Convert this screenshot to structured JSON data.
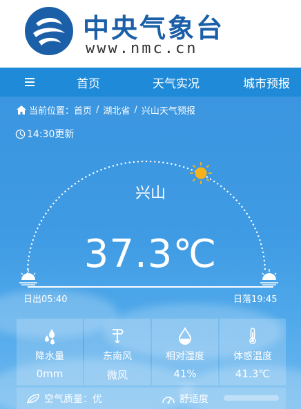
{
  "brand": {
    "name": "中央气象台",
    "url": "www.nmc.cn"
  },
  "nav": {
    "items": [
      {
        "label": "首页"
      },
      {
        "label": "天气实况"
      },
      {
        "label": "城市预报"
      }
    ]
  },
  "breadcrumb": {
    "prefix": "当前位置：",
    "home": "首页",
    "province": "湖北省",
    "page": "兴山天气预报",
    "separator": "/"
  },
  "update_time": "14:30更新",
  "city": "兴山",
  "temperature": "37.3℃",
  "sun": {
    "sunrise": "日出05:40",
    "sunset": "日落19:45"
  },
  "metrics": [
    {
      "icon": "raindrops-icon",
      "label": "降水量",
      "value": "0mm"
    },
    {
      "icon": "wind-vane-icon",
      "label": "东南风",
      "value": "微风"
    },
    {
      "icon": "humidity-drop-icon",
      "label": "相对湿度",
      "value": "41%"
    },
    {
      "icon": "thermometer-icon",
      "label": "体感温度",
      "value": "41.3℃"
    }
  ],
  "air_quality": {
    "label": "空气质量：优"
  },
  "comfort": {
    "label": "舒适度"
  },
  "colors": {
    "brand": "#1b5fa8",
    "nav": "#1e8ad8",
    "sky": "#3f9be3",
    "sun": "#f5b21a"
  }
}
